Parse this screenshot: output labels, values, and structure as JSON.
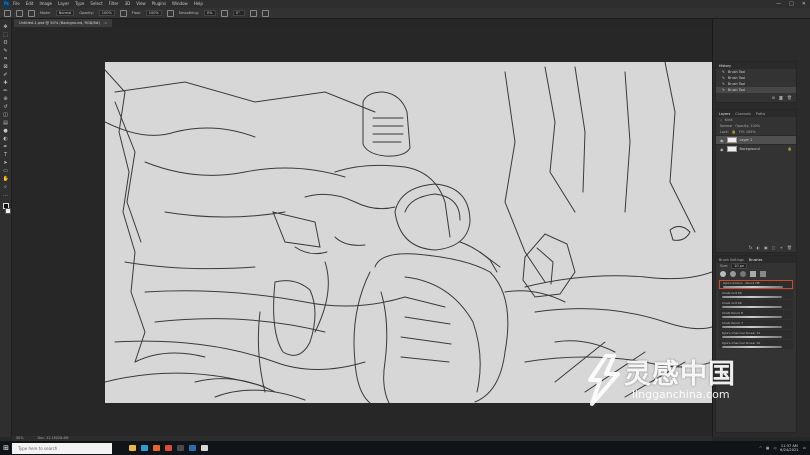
{
  "menubar": {
    "app_logo": "Ps",
    "items": [
      "File",
      "Edit",
      "Image",
      "Layer",
      "Type",
      "Select",
      "Filter",
      "3D",
      "View",
      "Plugins",
      "Window",
      "Help"
    ],
    "window_controls": [
      "—",
      "□",
      "✕"
    ]
  },
  "options": {
    "mode_label": "Mode:",
    "mode_value": "Normal",
    "opacity_label": "Opacity:",
    "opacity_value": "100%",
    "flow_label": "Flow:",
    "flow_value": "100%",
    "smoothing_label": "Smoothing:",
    "smoothing_value": "0%",
    "angle_value": "0°"
  },
  "document": {
    "tab_title": "Untitled-1.psd @ 50% (Background, RGB/8#)",
    "close": "×"
  },
  "toolbar": {
    "tools": [
      "move-icon",
      "marquee-icon",
      "lasso-icon",
      "quick-select-icon",
      "crop-icon",
      "frame-icon",
      "eyedropper-icon",
      "heal-icon",
      "brush-icon",
      "stamp-icon",
      "history-brush-icon",
      "eraser-icon",
      "gradient-icon",
      "blur-icon",
      "dodge-icon",
      "pen-icon",
      "type-icon",
      "path-select-icon",
      "shape-icon",
      "hand-icon",
      "zoom-icon",
      "more-icon"
    ],
    "glyphs": [
      "✥",
      "⬚",
      "ʘ",
      "✎",
      "⌗",
      "⊠",
      "✐",
      "✚",
      "✏",
      "⊕",
      "↺",
      "◫",
      "▤",
      "●",
      "◐",
      "✒",
      "T",
      "➤",
      "▭",
      "✋",
      "⌕",
      "…"
    ],
    "foreground_color": "#111111",
    "background_color": "#f2f2f2"
  },
  "history": {
    "tabs": [
      "History"
    ],
    "items": [
      "Brush Tool",
      "Brush Tool",
      "Brush Tool",
      "Brush Tool"
    ],
    "icons": [
      "⊞",
      "◙",
      "🗑"
    ]
  },
  "layers": {
    "tabs": [
      "Layers",
      "Channels",
      "Paths"
    ],
    "kind_label": "Kind",
    "blend_mode": "Normal",
    "opacity_label": "Opacity: 100%",
    "lock_label": "Lock:",
    "fill_label": "Fill: 100%",
    "items": [
      {
        "name": "Layer 1"
      },
      {
        "name": "Background"
      }
    ],
    "footer_icons": [
      "fx",
      "◐",
      "▣",
      "▢",
      "+",
      "🗑"
    ]
  },
  "brushes": {
    "tabs": [
      "Brush Settings",
      "Brushes"
    ],
    "size_label": "Size:",
    "size_value": "10 px",
    "items": [
      "Kyle's Inkbox - Pencil HB",
      "Chalk Grit 60",
      "Chalk Grit 60",
      "Chalk Pencil 8",
      "Chalk Pencil 7",
      "Kyle's Charcoal Smear 12",
      "Kyle's Charcoal Smear 16"
    ]
  },
  "status": {
    "zoom": "50%",
    "doc_size": "Doc: 22.1M/28.6M"
  },
  "taskbar": {
    "search_placeholder": "Type here to search",
    "time": "11:37 AM",
    "date": "6/24/2021",
    "apps": [
      {
        "name": "file-explorer-icon",
        "color": "#e8b84a"
      },
      {
        "name": "edge-icon",
        "color": "#2f9cd8"
      },
      {
        "name": "firefox-icon",
        "color": "#e6672e"
      },
      {
        "name": "chrome-icon",
        "color": "#e04a3a"
      },
      {
        "name": "obs-icon",
        "color": "#4a4a4a"
      },
      {
        "name": "photoshop-icon",
        "color": "#2a6fb0"
      },
      {
        "name": "clip-studio-icon",
        "color": "#d8d8d8"
      }
    ]
  },
  "watermark": {
    "chinese_text": "灵感中国",
    "url_text": "lingganchina.com"
  }
}
